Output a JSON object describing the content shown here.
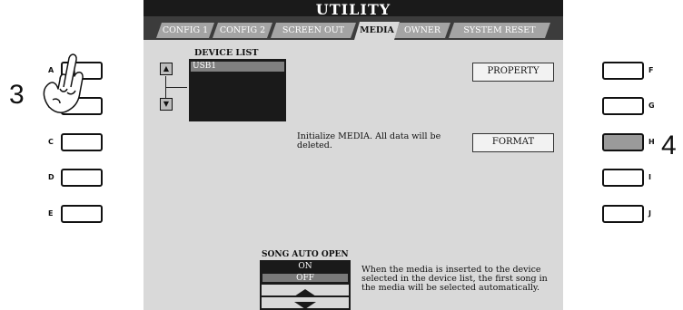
{
  "screen": {
    "title": "UTILITY",
    "tabs": [
      "CONFIG 1",
      "CONFIG 2",
      "SCREEN OUT",
      "MEDIA",
      "OWNER",
      "SYSTEM RESET"
    ],
    "active_tab": "MEDIA",
    "device_list_label": "DEVICE LIST",
    "device_items": [
      "USB1"
    ],
    "property_button": "PROPERTY",
    "format_message": "Initialize MEDIA. All data will be deleted.",
    "format_button": "FORMAT",
    "song_auto_open": {
      "label": "SONG AUTO OPEN",
      "options": [
        "ON",
        "OFF"
      ],
      "selected": "OFF",
      "description": "When the media is inserted to the device selected in the device list, the first song in the media will be selected automatically."
    }
  },
  "left_buttons": [
    "A",
    "B",
    "C",
    "D",
    "E"
  ],
  "right_buttons": [
    "F",
    "G",
    "H",
    "I",
    "J"
  ],
  "step_numbers": [
    "3",
    "4"
  ]
}
